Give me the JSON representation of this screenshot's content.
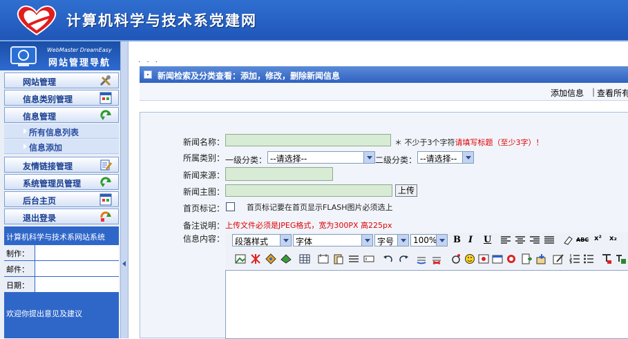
{
  "header": {
    "site_title": "计算机科学与技术系党建网"
  },
  "sidebar": {
    "brand_subtitle": "WebMaster DreamEasy",
    "brand_title": "网站管理导航",
    "menu": [
      {
        "label": "网站管理",
        "icon": "tools-icon"
      },
      {
        "label": "信息类别管理",
        "icon": "window-icon"
      },
      {
        "label": "信息管理",
        "icon": "recycle-arrow-icon"
      },
      {
        "label": "友情链接管理",
        "icon": "edit-note-icon"
      },
      {
        "label": "系统管理员管理",
        "icon": "recycle-arrow-icon"
      },
      {
        "label": "后台主页",
        "icon": "window-icon"
      },
      {
        "label": "退出登录",
        "icon": "logout-icon"
      }
    ],
    "submenu": [
      {
        "label": "所有信息列表"
      },
      {
        "label": "信息添加"
      }
    ],
    "info": {
      "title": "计算机科学与技术系网站系统",
      "rows": [
        {
          "label": "制作："
        },
        {
          "label": "邮件："
        },
        {
          "label": "日期："
        }
      ],
      "footer": "欢迎你提出意见及建议"
    }
  },
  "main": {
    "dots": ". . .",
    "section_title": "新闻检索及分类查看：添加，修改，删除新闻信息",
    "links": {
      "add": "添加信息",
      "separator": "|",
      "view_all": "查看所有"
    },
    "form": {
      "title_label": "新闻名称：",
      "title_hint_prefix": "＊ 不少于3个字符",
      "title_hint_warning": "请填写标题（至少3字）！",
      "category_label": "所属类别：",
      "level1_label": "一级分类：",
      "level1_value": "--请选择--",
      "level2_label": "二级分类：",
      "level2_value": "--请选择--",
      "source_label": "新闻来源：",
      "image_label": "新闻主图：",
      "upload_button": "上传",
      "homepage_label": "首页标记：",
      "homepage_hint": "首页标记要在首页显示FLASH图片必须选上",
      "note_label": "备注说明：",
      "note_text": "上传文件必须是JPEG格式，宽为300PX 高225px",
      "content_label": "信息内容："
    },
    "editor": {
      "paragraph_style": "段落样式",
      "font": "字体",
      "font_size": "字号",
      "zoom": "100%",
      "bold": "B",
      "italic": "I",
      "underline": "U",
      "strike": "ABC",
      "superscript": "x²",
      "subscript": "x₂"
    }
  },
  "colors": {
    "header_blue": "#1f56b8",
    "field_green": "#d7ebd5",
    "warning_red": "#e00000"
  }
}
